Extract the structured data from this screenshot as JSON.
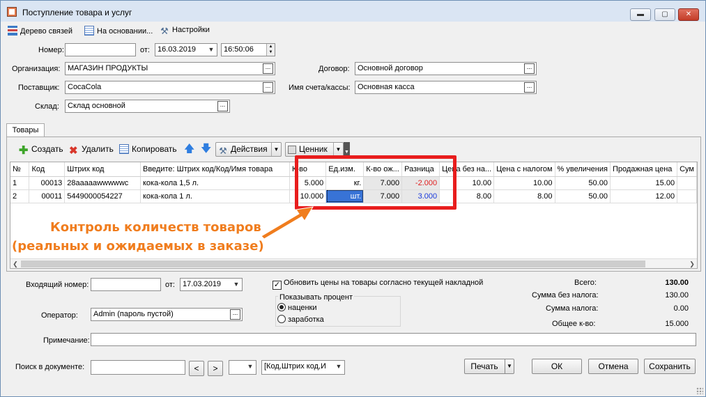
{
  "window": {
    "title": "Поступление товара и услуг",
    "min_label": "▬",
    "max_label": "▢",
    "close_label": "✕"
  },
  "toolbar": {
    "tree_label": "Дерево связей",
    "based_label": "На основании...",
    "settings_label": "Настройки"
  },
  "header": {
    "number_label": "Номер:",
    "number_value": "",
    "from_label": "от:",
    "date_value": "16.03.2019",
    "time_value": "16:50:06",
    "org_label": "Организация:",
    "org_value": "МАГАЗИН ПРОДУКТЫ",
    "supplier_label": "Поставщик:",
    "supplier_value": "CocaCola",
    "warehouse_label": "Склад:",
    "warehouse_value": "Склад основной",
    "contract_label": "Договор:",
    "contract_value": "Основной договор",
    "account_label": "Имя счета/кассы:",
    "account_value": "Основная касса",
    "dots": "..."
  },
  "tabs": {
    "goods_label": "Товары"
  },
  "grid_toolbar": {
    "create_label": "Создать",
    "delete_label": "Удалить",
    "copy_label": "Копировать",
    "actions_label": "Действия",
    "pricetag_label": "Ценник"
  },
  "table": {
    "columns": [
      "№",
      "Код",
      "Штрих код",
      "Введите: Штрих код/Код/Имя товара",
      "К-во",
      "Ед.изм.",
      "К-во ож...",
      "Разница",
      "Цена без на...",
      "Цена с налогом",
      "% увеличения",
      "Продажная цена",
      "Сум"
    ],
    "rows": [
      [
        "1",
        "00013",
        "28aaaaawwwwwc",
        "кока-кола 1,5 л.",
        "5.000",
        "кг.",
        "7.000",
        "-2.000",
        "10.00",
        "10.00",
        "50.00",
        "15.00",
        ""
      ],
      [
        "2",
        "00011",
        "5449000054227",
        "кока-кола 1 л.",
        "10.000",
        "шт.",
        "7.000",
        "3.000",
        "8.00",
        "8.00",
        "50.00",
        "12.00",
        ""
      ]
    ]
  },
  "annotation": {
    "line1": "Контроль количеств товаров",
    "line2": "(реальных и ожидаемых в заказе)"
  },
  "footer": {
    "incoming_label": "Входящий номер:",
    "incoming_value": "",
    "from_label": "от:",
    "incoming_date": "17.03.2019",
    "update_prices_label": "Обновить цены на товары согласно текущей накладной",
    "update_prices_checked": true,
    "show_percent_label": "Показывать процент",
    "markup_label": "наценки",
    "profit_label": "заработка",
    "operator_label": "Оператор:",
    "operator_value": "Admin (пароль пустой)",
    "note_label": "Примечание:",
    "note_value": "",
    "total_label": "Всего:",
    "total_value": "130.00",
    "sum_no_tax_label": "Сумма без налога:",
    "sum_no_tax_value": "130.00",
    "tax_label": "Сумма налога:",
    "tax_value": "0.00",
    "qty_label": "Общее к-во:",
    "qty_value": "15.000",
    "search_label": "Поиск в документе:",
    "search_value": "",
    "prev_label": "<",
    "next_label": ">",
    "search_field_value": "[Код,Штрих код,И",
    "print_label": "Печать",
    "ok_label": "ОК",
    "cancel_label": "Отмена",
    "save_label": "Сохранить"
  },
  "colors": {
    "negative": "#e02020",
    "positive": "#1a3adb",
    "highlight_box": "#e81d1d",
    "annotation": "#f07d1e",
    "selection": "#3873d6"
  }
}
